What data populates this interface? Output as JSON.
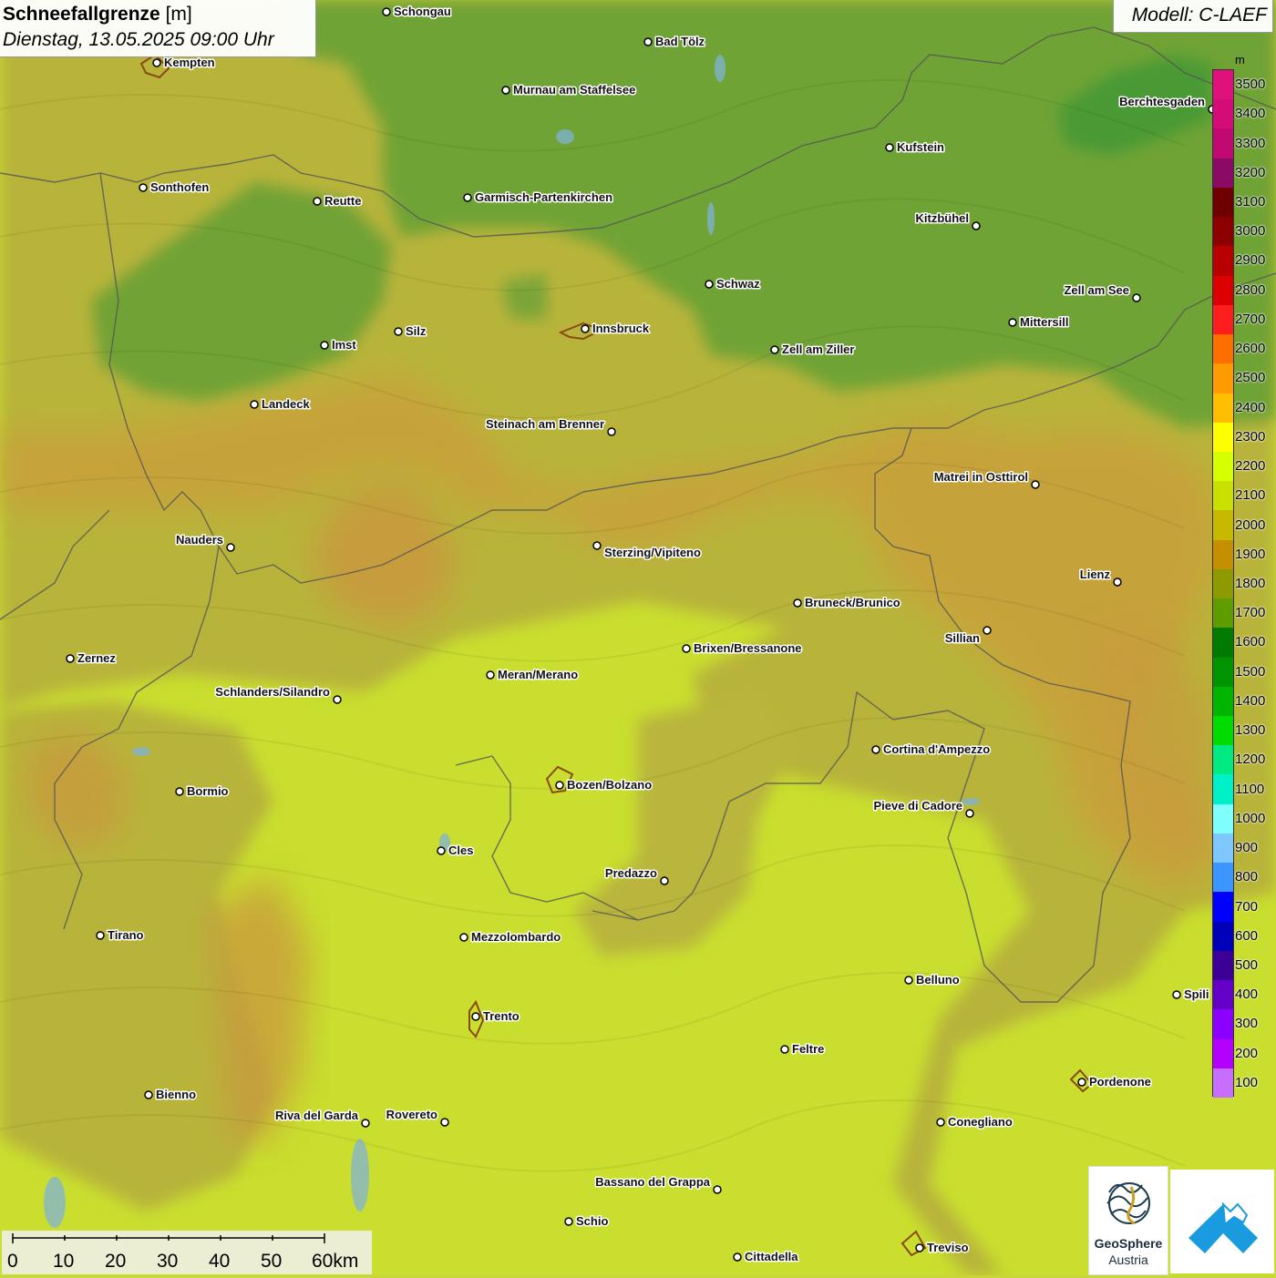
{
  "header": {
    "title_bold": "Schneefallgrenze",
    "title_unit": "[m]",
    "datetime": "Dienstag, 13.05.2025 09:00 Uhr",
    "model": "Modell: C-LAEF"
  },
  "legend": {
    "unit": "m",
    "items": [
      {
        "label": "3500",
        "color": "#e0117a"
      },
      {
        "label": "3400",
        "color": "#d30c78"
      },
      {
        "label": "3300",
        "color": "#c00a72"
      },
      {
        "label": "3200",
        "color": "#8a0a66"
      },
      {
        "label": "3100",
        "color": "#6e0000"
      },
      {
        "label": "3000",
        "color": "#8c0000"
      },
      {
        "label": "2900",
        "color": "#b80000"
      },
      {
        "label": "2800",
        "color": "#dd0000"
      },
      {
        "label": "2700",
        "color": "#ff1e1e"
      },
      {
        "label": "2600",
        "color": "#ff6f00"
      },
      {
        "label": "2500",
        "color": "#ff9a00"
      },
      {
        "label": "2400",
        "color": "#ffbe00"
      },
      {
        "label": "2300",
        "color": "#ffff00"
      },
      {
        "label": "2200",
        "color": "#d6ff00"
      },
      {
        "label": "2100",
        "color": "#c9e000"
      },
      {
        "label": "2000",
        "color": "#c6b900"
      },
      {
        "label": "1900",
        "color": "#c49000"
      },
      {
        "label": "1800",
        "color": "#8e9b00"
      },
      {
        "label": "1700",
        "color": "#5f9c00"
      },
      {
        "label": "1600",
        "color": "#007a00"
      },
      {
        "label": "1500",
        "color": "#009400"
      },
      {
        "label": "1400",
        "color": "#00b400"
      },
      {
        "label": "1300",
        "color": "#00dc00"
      },
      {
        "label": "1200",
        "color": "#00ea82"
      },
      {
        "label": "1100",
        "color": "#00f0c8"
      },
      {
        "label": "1000",
        "color": "#80ffff"
      },
      {
        "label": "900",
        "color": "#7fc8ff"
      },
      {
        "label": "800",
        "color": "#3c96ff"
      },
      {
        "label": "700",
        "color": "#0000ff"
      },
      {
        "label": "600",
        "color": "#0000b8"
      },
      {
        "label": "500",
        "color": "#3c0096"
      },
      {
        "label": "400",
        "color": "#6400c8"
      },
      {
        "label": "300",
        "color": "#8c00ff"
      },
      {
        "label": "200",
        "color": "#b400ff"
      },
      {
        "label": "100",
        "color": "#c86eff"
      }
    ]
  },
  "cities": [
    {
      "name": "Schongau"
    },
    {
      "name": "Bad Tölz"
    },
    {
      "name": "Kempten"
    },
    {
      "name": "Murnau am Staffelsee"
    },
    {
      "name": "Berchtesgaden"
    },
    {
      "name": "Kufstein"
    },
    {
      "name": "Sonthofen"
    },
    {
      "name": "Reutte"
    },
    {
      "name": "Garmisch-Partenkirchen"
    },
    {
      "name": "Kitzbühel"
    },
    {
      "name": "Schwaz"
    },
    {
      "name": "Zell am See"
    },
    {
      "name": "Innsbruck"
    },
    {
      "name": "Mittersill"
    },
    {
      "name": "Imst"
    },
    {
      "name": "Silz"
    },
    {
      "name": "Zell am Ziller"
    },
    {
      "name": "Landeck"
    },
    {
      "name": "Steinach am Brenner"
    },
    {
      "name": "Matrei in Osttirol"
    },
    {
      "name": "Nauders"
    },
    {
      "name": "Sterzing/Vipiteno"
    },
    {
      "name": "Lienz"
    },
    {
      "name": "Bruneck/Brunico"
    },
    {
      "name": "Sillian"
    },
    {
      "name": "Brixen/Bressanone"
    },
    {
      "name": "Zernez"
    },
    {
      "name": "Meran/Merano"
    },
    {
      "name": "Schlanders/Silandro"
    },
    {
      "name": "Cortina d'Ampezzo"
    },
    {
      "name": "Bozen/Bolzano"
    },
    {
      "name": "Bormio"
    },
    {
      "name": "Pieve di Cadore"
    },
    {
      "name": "Cles"
    },
    {
      "name": "Predazzo"
    },
    {
      "name": "Tirano"
    },
    {
      "name": "Mezzolombardo"
    },
    {
      "name": "Belluno"
    },
    {
      "name": "Spili"
    },
    {
      "name": "Trento"
    },
    {
      "name": "Feltre"
    },
    {
      "name": "Pordenone"
    },
    {
      "name": "Bienno"
    },
    {
      "name": "Riva del Garda"
    },
    {
      "name": "Rovereto"
    },
    {
      "name": "Conegliano"
    },
    {
      "name": "Bassano del Grappa"
    },
    {
      "name": "Schio"
    },
    {
      "name": "Treviso"
    },
    {
      "name": "Cittadella"
    }
  ],
  "scale": {
    "labels": [
      "0",
      "10",
      "20",
      "30",
      "40",
      "50",
      "60km"
    ]
  },
  "logos": {
    "geosphere_name": "GeoSphere",
    "geosphere_sub": "Austria"
  }
}
